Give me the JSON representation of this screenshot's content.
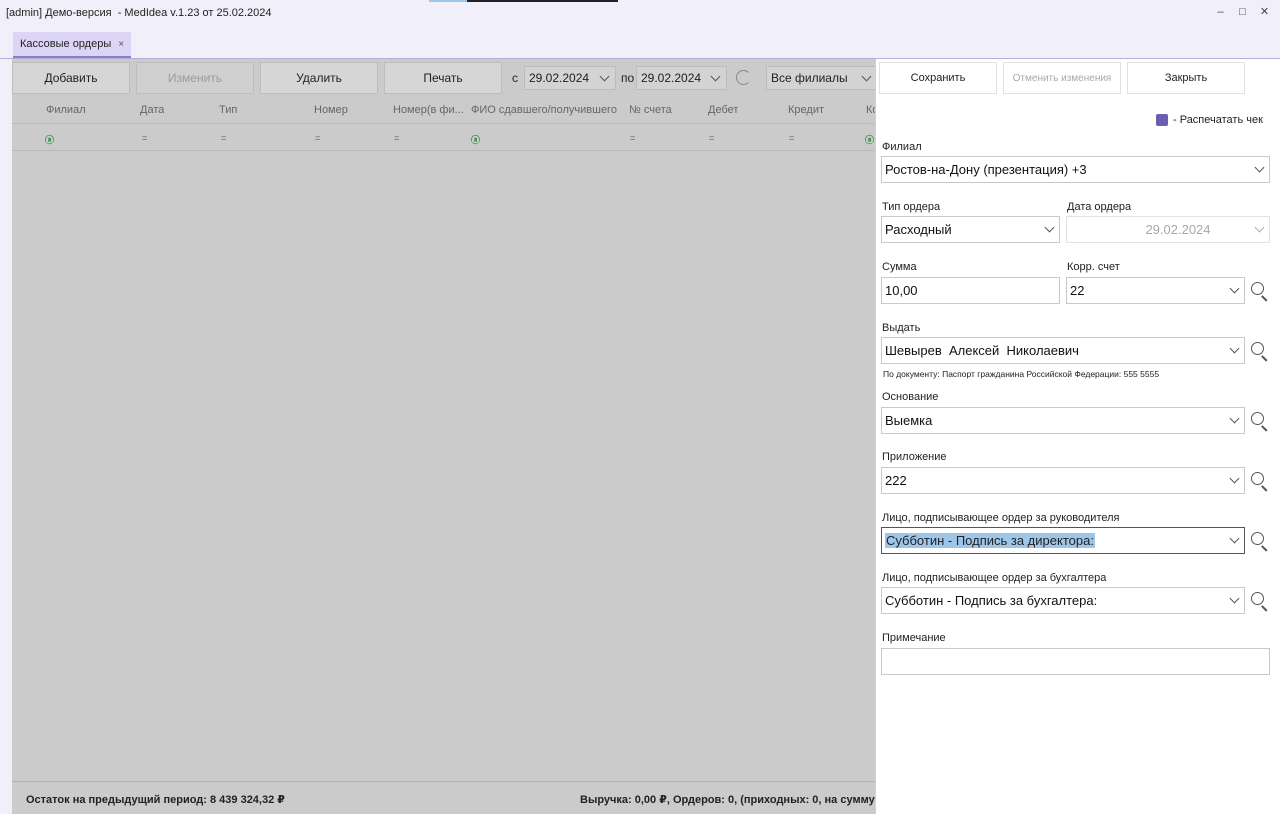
{
  "window": {
    "title": "[admin] Демо-версия  - MedIdea v.1.23 от 25.02.2024",
    "minimize_icon": "minimize-icon",
    "maximize_icon": "maximize-icon",
    "close_icon": "close-icon"
  },
  "tabs": [
    {
      "label": "Кассовые ордеры",
      "close": "×"
    }
  ],
  "toolbar": {
    "add_label": "Добавить",
    "edit_label": "Изменить",
    "delete_label": "Удалить",
    "print_label": "Печать",
    "from_label": "с",
    "date_from": "29.02.2024",
    "to_label": "по",
    "date_to": "29.02.2024",
    "branches_filter": "Все филиалы"
  },
  "grid": {
    "columns": [
      "Филиал",
      "Дата",
      "Тип",
      "Номер",
      "Номер(в фи...",
      "ФИО сдавшего/получившего",
      "№ счета",
      "Дебет",
      "Кредит",
      "Ко"
    ],
    "filter_marks": [
      "ⓐ",
      "=",
      "=",
      "=",
      "=",
      "ⓐ",
      "=",
      "=",
      "=",
      "ⓐ"
    ]
  },
  "footer": {
    "prev_balance": "Остаток на предыдущий период: 8 439 324,32 ₽",
    "revenue": "Выручка: 0,00 ₽, Ордеров: 0, (приходных: 0, на сумму:"
  },
  "editor": {
    "save_label": "Сохранить",
    "cancel_label": "Отменить изменения",
    "close_label": "Закрыть",
    "print_check_label": "- Распечатать чек",
    "branch": {
      "label": "Филиал",
      "value": "Ростов-на-Дону (презентация) +3"
    },
    "order_type": {
      "label": "Тип ордера",
      "value": "Расходный"
    },
    "order_date": {
      "label": "Дата ордера",
      "value": "29.02.2024"
    },
    "amount": {
      "label": "Сумма",
      "value": "10,00"
    },
    "corr_account": {
      "label": "Корр. счет",
      "value": "22"
    },
    "issue_to": {
      "label": "Выдать",
      "value": "Шевырев  Алексей  Николаевич"
    },
    "document_note": "По документу: Паспорт гражданина Российской Федерации: 555 5555",
    "basis": {
      "label": "Основание",
      "value": "Выемка"
    },
    "attachment": {
      "label": "Приложение",
      "value": "222"
    },
    "signer_head": {
      "label": "Лицо, подписывающее ордер за руководителя",
      "value": "Субботин - Подпись за директора:"
    },
    "signer_accountant": {
      "label": "Лицо, подписывающее ордер за бухгалтера",
      "value": "Субботин - Подпись за бухгалтера:"
    },
    "comment": {
      "label": "Примечание",
      "value": ""
    }
  },
  "colors": {
    "accent": "#6b5db0",
    "tab_bg": "#ddd5f5",
    "selection": "#9ec6e8",
    "overlay_gray": "#cbcbcb"
  }
}
